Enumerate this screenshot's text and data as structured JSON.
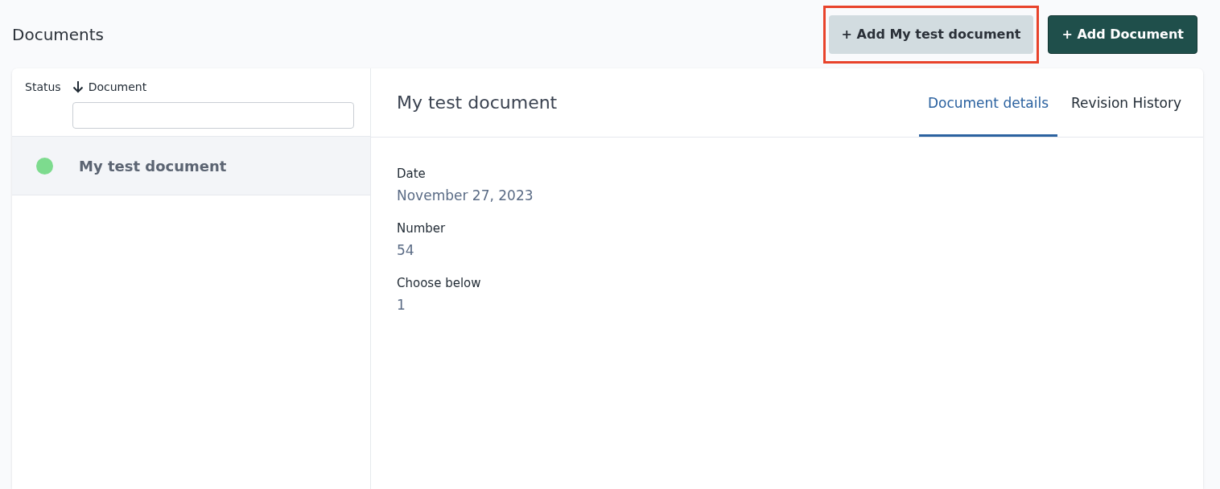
{
  "page": {
    "title": "Documents"
  },
  "actions": [
    {
      "label": "+ Add My test document",
      "kind": "secondary",
      "highlighted": true
    },
    {
      "label": "+ Add Document",
      "kind": "primary",
      "highlighted": false
    }
  ],
  "list": {
    "columns": [
      "Status",
      "Document"
    ],
    "rows": [
      {
        "title": "My test document",
        "color": "#7ddb8e",
        "selected": true
      }
    ]
  },
  "detail": {
    "title": "My test document",
    "tabs": [
      {
        "label": "Document details",
        "selected": true
      },
      {
        "label": "Revision History",
        "selected": false
      }
    ],
    "fields": [
      {
        "label": "Date",
        "value": "November 27, 2023"
      },
      {
        "label": "Number",
        "value": "54"
      },
      {
        "label": "Choose below",
        "value": "1"
      }
    ]
  }
}
